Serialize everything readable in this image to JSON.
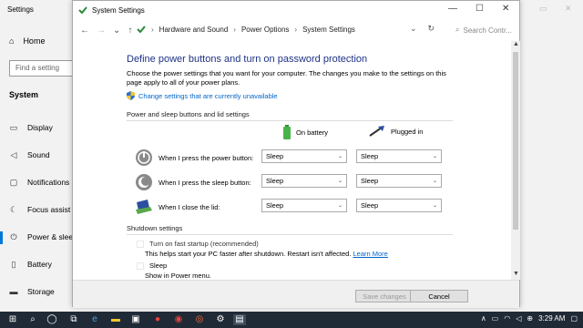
{
  "settings_bg": {
    "title": "Settings",
    "home": "Home",
    "find_placeholder": "Find a setting",
    "system": "System",
    "items": [
      {
        "label": "Display",
        "icon": "monitor-icon"
      },
      {
        "label": "Sound",
        "icon": "speaker-icon"
      },
      {
        "label": "Notifications",
        "icon": "notification-icon"
      },
      {
        "label": "Focus assist",
        "icon": "moon-icon"
      },
      {
        "label": "Power & slee",
        "icon": "power-icon"
      },
      {
        "label": "Battery",
        "icon": "battery-icon"
      },
      {
        "label": "Storage",
        "icon": "storage-icon"
      }
    ]
  },
  "window": {
    "title": "System Settings",
    "breadcrumb": [
      "Hardware and Sound",
      "Power Options",
      "System Settings"
    ],
    "search_placeholder": "Search Contr...",
    "heading": "Define power buttons and turn on password protection",
    "description": "Choose the power settings that you want for your computer. The changes you make to the settings on this page apply to all of your power plans.",
    "change_link": "Change settings that are currently unavailable",
    "section1_title": "Power and sleep buttons and lid settings",
    "col_battery": "On battery",
    "col_plugged": "Plugged in",
    "rows": [
      {
        "label": "When I press the power button:",
        "battery": "Sleep",
        "plugged": "Sleep"
      },
      {
        "label": "When I press the sleep button:",
        "battery": "Sleep",
        "plugged": "Sleep"
      },
      {
        "label": "When I close the lid:",
        "battery": "Sleep",
        "plugged": "Sleep"
      }
    ],
    "section2_title": "Shutdown settings",
    "fast_startup": "Turn on fast startup (recommended)",
    "fast_startup_desc": "This helps start your PC faster after shutdown. Restart isn't affected.",
    "learn_more": "Learn More",
    "sleep_label": "Sleep",
    "sleep_desc": "Show in Power menu.",
    "save_button": "Save changes",
    "cancel_button": "Cancel"
  },
  "taskbar": {
    "time": "3:29 AM"
  }
}
